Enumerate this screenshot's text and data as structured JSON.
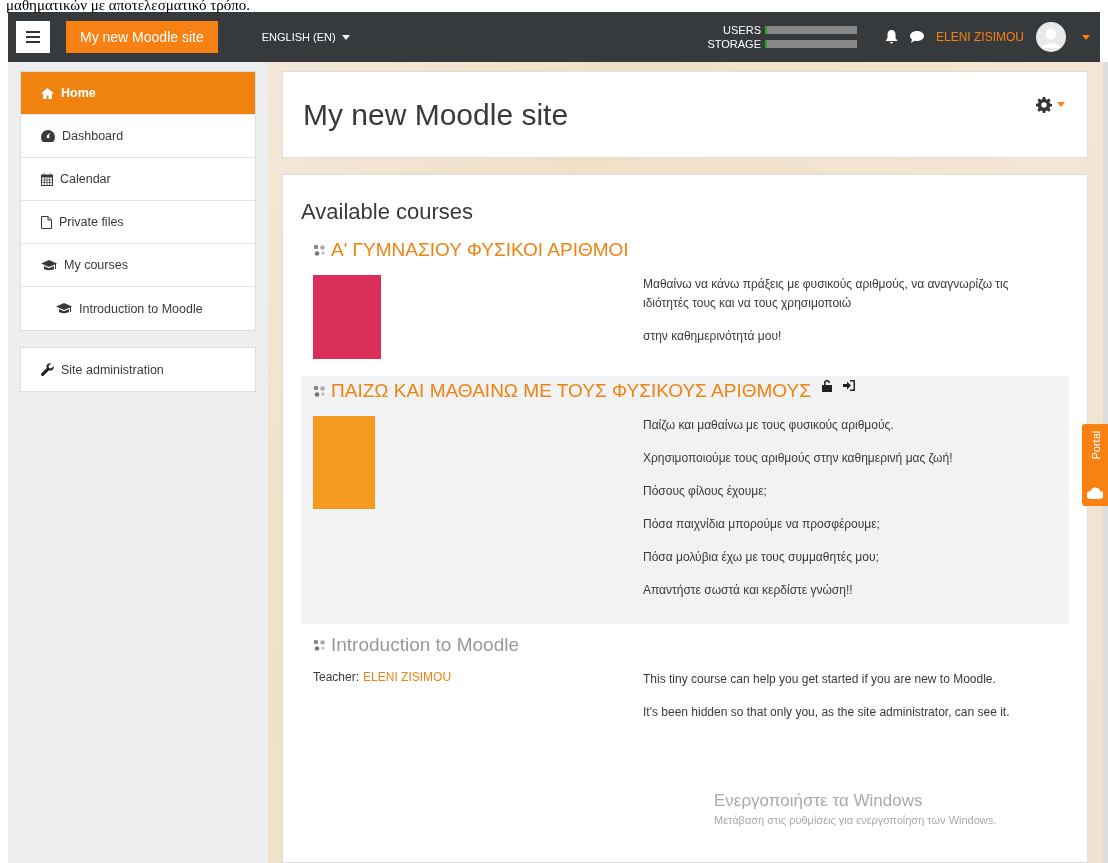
{
  "top_text": "μαθηματικών με αποτελεσματικό τρόπο.",
  "navbar": {
    "site_name": "My new Moodle site",
    "language": "ENGLISH (EN)",
    "quota": [
      {
        "label": "USERS",
        "level": 0.02
      },
      {
        "label": "STORAGE",
        "level": 0.02
      }
    ],
    "user_name": "ELENI ZISIMOU"
  },
  "sidebar": {
    "items": [
      {
        "label": "Home",
        "kind": "home",
        "selected": true,
        "indented": false
      },
      {
        "label": "Dashboard",
        "kind": "dashboard",
        "selected": false,
        "indented": false
      },
      {
        "label": "Calendar",
        "kind": "calendar",
        "selected": false,
        "indented": false
      },
      {
        "label": "Private files",
        "kind": "file",
        "selected": false,
        "indented": false
      },
      {
        "label": "My courses",
        "kind": "course",
        "selected": false,
        "indented": false
      },
      {
        "label": "Introduction to Moodle",
        "kind": "course",
        "selected": false,
        "indented": true
      }
    ],
    "admin": {
      "label": "Site administration"
    }
  },
  "header": {
    "title": "My new Moodle site"
  },
  "courses_section": {
    "title": "Available courses",
    "courses": [
      {
        "name": "Α' ΓΥΜΝΑΣΙΟΥ ΦΥΣΙΚΟΙ ΑΡΙΘΜΟΙ",
        "hidden": false,
        "highlighted": false,
        "enrol_icons": false,
        "kind": "cover",
        "summary": [
          "Μαθαίνω να κάνω πράξεις με φυσικούς αριθμούς, να αναγνωρίζω τις ιδιότητές τους και να τους χρησιμοποιώ",
          "στην καθημερινότητά μου!"
        ]
      },
      {
        "name": "ΠΑΙΖΩ ΚΑΙ ΜΑΘΑΙΝΩ ΜΕ ΤΟΥΣ ΦΥΣΙΚΟΥΣ ΑΡΙΘΜΟΥΣ",
        "hidden": false,
        "highlighted": true,
        "enrol_icons": true,
        "kind": "cover",
        "summary": [
          "Παίζω και μαθαίνω με τους φυσικούς αριθμούς.",
          "Χρησιμοποιούμε τους αριθμούς στην καθημερινή μας ζωή!",
          "Πόσους φίλους έχουμε;",
          "Πόσα παιχνίδια μπορούμε να προσφέρουμε;",
          "Πόσα μολύβια έχω με τους συμμαθητές μου;",
          "Απαντήστε σωστά και κερδίστε γνώση!!"
        ]
      },
      {
        "name": "Introduction to Moodle",
        "hidden": true,
        "highlighted": false,
        "enrol_icons": false,
        "kind": "teacher",
        "teacher_label": "Teacher:",
        "teacher": "ELENI ZISIMOU",
        "summary": [
          "This tiny course can help you get started if you are new to Moodle.",
          "It's been hidden so that only you, as the site administrator, can see it."
        ]
      }
    ]
  },
  "portal_tab": {
    "label": "Portal"
  },
  "activation": {
    "title": "Ενεργοποιήστε τα Windows",
    "subtitle": "Μετάβαση στις ρυθμίσεις για ενεργοποίηση των Windows."
  }
}
